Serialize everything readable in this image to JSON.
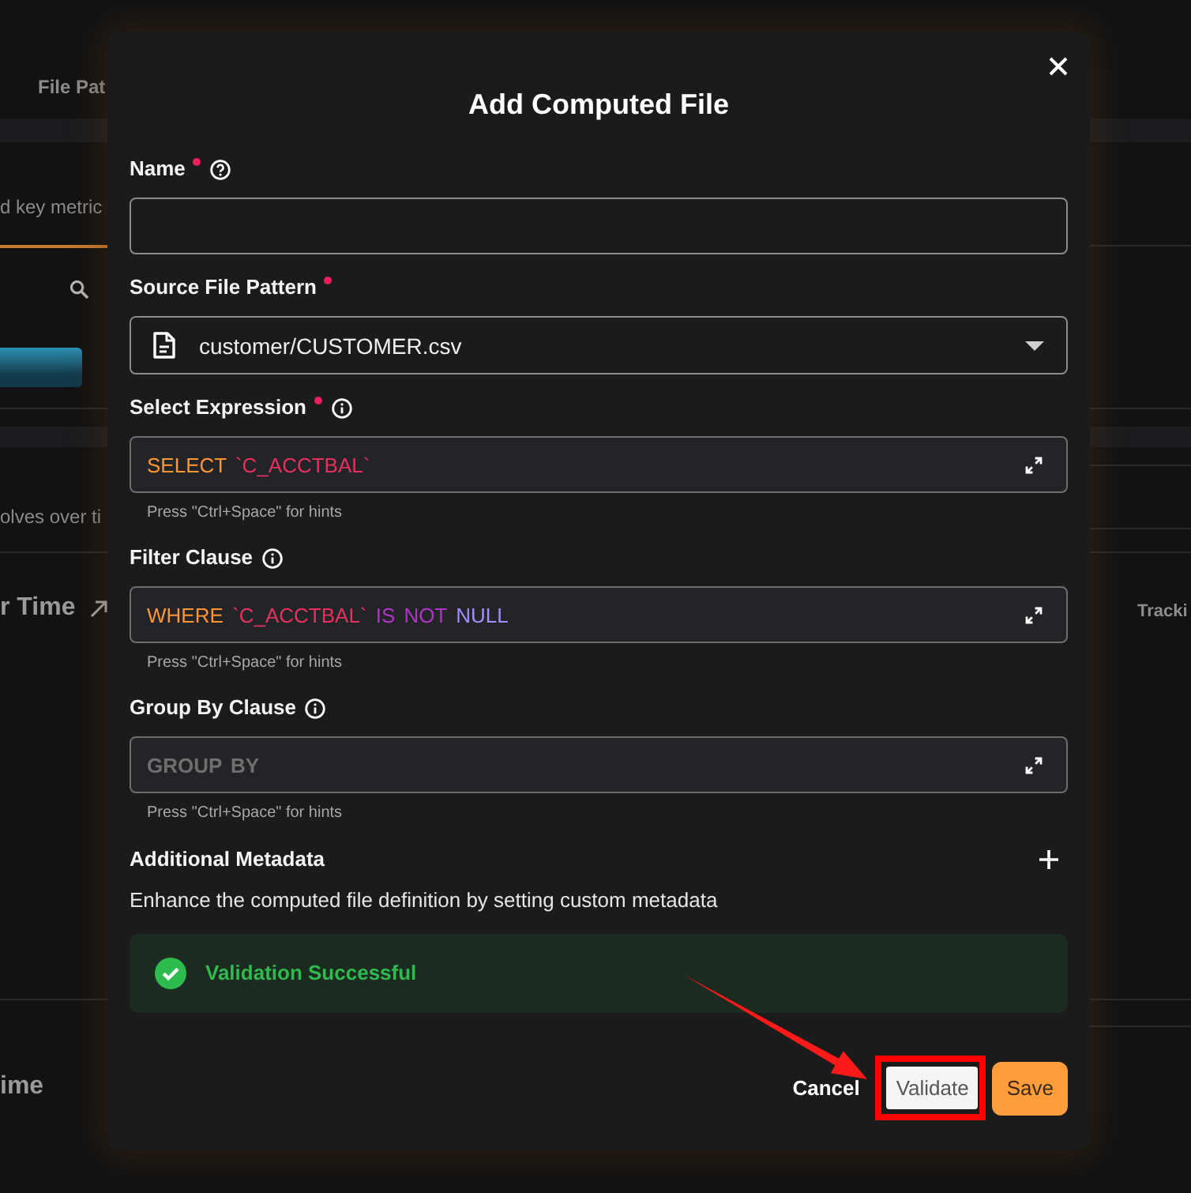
{
  "background": {
    "tab_label": "File Pat",
    "summary": "d key metric",
    "caption": "olves over ti",
    "section_title": "r Time",
    "side_label": "Tracki",
    "bottom_title": "ime"
  },
  "dialog": {
    "title": "Add Computed File",
    "fields": [
      {
        "kind": "text",
        "label": "Name",
        "required": true,
        "help": true
      },
      {
        "kind": "select",
        "label": "Source File Pattern",
        "required": true,
        "help": false,
        "value": "customer/CUSTOMER.csv"
      },
      {
        "kind": "editor",
        "label": "Select Expression",
        "required": true,
        "help": true,
        "tokens": [
          {
            "text": "SELECT",
            "color": "#ff9534"
          },
          {
            "text": "`C_ACCTBAL`",
            "color": "#e8305f"
          }
        ],
        "hint": "Press \"Ctrl+Space\" for hints"
      },
      {
        "kind": "editor",
        "label": "Filter Clause",
        "required": false,
        "help": true,
        "tokens": [
          {
            "text": "WHERE",
            "color": "#ff9534"
          },
          {
            "text": "`C_ACCTBAL`",
            "color": "#e8305f"
          },
          {
            "text": "IS NOT",
            "color": "#b133c9"
          },
          {
            "text": "NULL",
            "color": "#a48cff"
          }
        ],
        "hint": "Press \"Ctrl+Space\" for hints"
      },
      {
        "kind": "editor",
        "label": "Group By Clause",
        "required": false,
        "help": true,
        "placeholder": "GROUP BY",
        "hint": "Press \"Ctrl+Space\" for hints"
      }
    ],
    "metadata": {
      "title": "Additional Metadata",
      "description": "Enhance the computed file definition by setting custom metadata"
    },
    "message": {
      "kind": "success",
      "text": "Validation Successful"
    },
    "buttons": [
      {
        "kind": "text",
        "label": "Cancel",
        "highlighted": false
      },
      {
        "kind": "secondary",
        "label": "Validate",
        "highlighted": true
      },
      {
        "kind": "primary",
        "label": "Save",
        "highlighted": false
      }
    ]
  }
}
